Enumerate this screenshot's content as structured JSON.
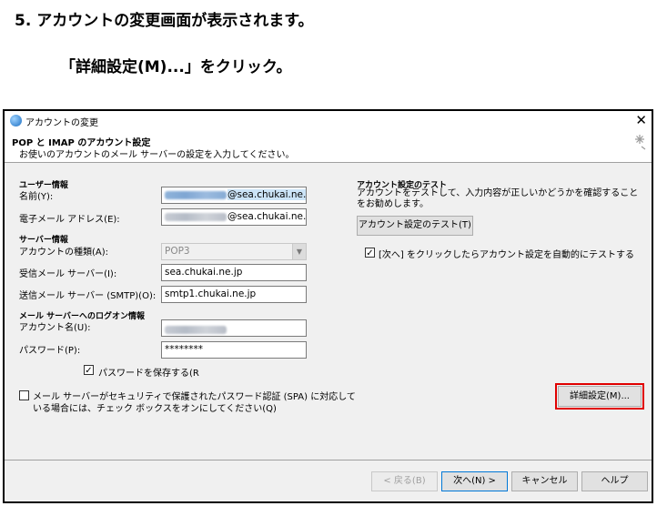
{
  "instruction": {
    "step": "5.  アカウントの変更画面が表示されます。",
    "action": "「詳細設定(M)...」をクリック。"
  },
  "window": {
    "title": "アカウントの変更",
    "close_glyph": "✕"
  },
  "header": {
    "title": "POP と IMAP のアカウント設定",
    "subtitle": "お使いのアカウントのメール サーバーの設定を入力してください。"
  },
  "user_info": {
    "section": "ユーザー情報",
    "name_label": "名前(Y):",
    "name_value_suffix": "@sea.chukai.ne.jp",
    "email_label": "電子メール アドレス(E):",
    "email_value_suffix": "@sea.chukai.ne.jp"
  },
  "server_info": {
    "section": "サーバー情報",
    "account_type_label": "アカウントの種類(A):",
    "account_type_value": "POP3",
    "incoming_label": "受信メール サーバー(I):",
    "incoming_value": "sea.chukai.ne.jp",
    "outgoing_label": "送信メール サーバー (SMTP)(O):",
    "outgoing_value": "smtp1.chukai.ne.jp"
  },
  "logon_info": {
    "section": "メール サーバーへのログオン情報",
    "account_name_label": "アカウント名(U):",
    "password_label": "パスワード(P):",
    "password_value": "********",
    "save_password_label": "パスワードを保存する(R",
    "save_password_checked": true
  },
  "spa": {
    "label_line1": "メール サーバーがセキュリティで保護されたパスワード認証 (SPA) に対応して",
    "label_line2": "いる場合には、チェック ボックスをオンにしてください(Q)",
    "checked": false
  },
  "test": {
    "section": "アカウント設定のテスト",
    "description": "アカウントをテストして、入力内容が正しいかどうかを確認することをお勧めします。",
    "button": "アカウント設定のテスト(T)",
    "auto_test_label": "[次へ] をクリックしたらアカウント設定を自動的にテストする",
    "auto_test_checked": true
  },
  "advanced_button": "詳細設定(M)...",
  "footer": {
    "back": "< 戻る(B)",
    "next": "次へ(N) >",
    "cancel": "キャンセル",
    "help": "ヘルプ"
  },
  "colors": {
    "highlight": "#e00000",
    "focus": "#0078d7",
    "selection": "#cce4f7"
  },
  "icons": [
    "app-globe-icon",
    "close-icon",
    "sparkle-icon",
    "chevron-down-icon",
    "checkmark-icon"
  ]
}
